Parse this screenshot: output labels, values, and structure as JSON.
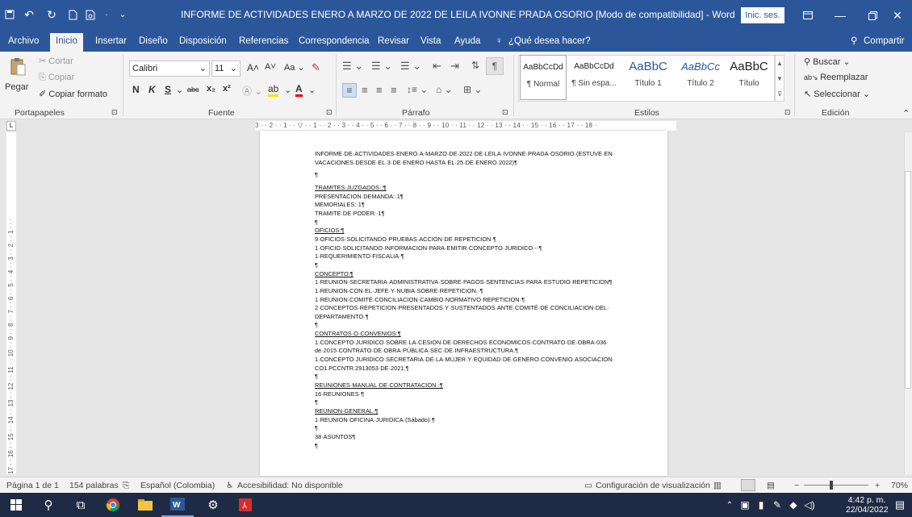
{
  "titlebar": {
    "title": "INFORME DE ACTIVIDADES ENERO A MARZO DE 2022 DE LEILA IVONNE PRADA OSORIO [Modo de compatibilidad]  -  Word",
    "signin": "Inic. ses.",
    "icons": [
      "save-icon",
      "undo-icon",
      "redo-icon",
      "new-document-icon",
      "print-preview-icon",
      "customize-icon"
    ]
  },
  "tabs": [
    "Archivo",
    "Inicio",
    "Insertar",
    "Diseño",
    "Disposición",
    "Referencias",
    "Correspondencia",
    "Revisar",
    "Vista",
    "Ayuda"
  ],
  "tell_me": "¿Qué desea hacer?",
  "share": "Compartir",
  "ribbon": {
    "clipboard": {
      "paste": "Pegar",
      "cut": "Cortar",
      "copy": "Copiar",
      "format_painter": "Copiar formato",
      "label": "Portapapeles"
    },
    "font": {
      "name": "Calibri",
      "size": "11",
      "case": "Aa",
      "bold": "N",
      "italic": "K",
      "underline": "S",
      "strike": "abc",
      "sub": "x₂",
      "sup": "x²",
      "label": "Fuente"
    },
    "paragraph": {
      "label": "Párrafo"
    },
    "styles": {
      "items": [
        {
          "preview": "AaBbCcDd",
          "name": "¶ Normal"
        },
        {
          "preview": "AaBbCcDd",
          "name": "¶ Sin espa..."
        },
        {
          "preview": "AaBbC",
          "name": "Título 1"
        },
        {
          "preview": "AaBbCc",
          "name": "Título 2"
        },
        {
          "preview": "AaBbC",
          "name": "Título"
        }
      ],
      "label": "Estilos"
    },
    "editing": {
      "find": "Buscar",
      "replace": "Reemplazar",
      "select": "Seleccionar",
      "label": "Edición"
    }
  },
  "ruler": {
    "h": "3 · · 2 · · 1 · · ▽ · · 1 · · 2 · · 3 · · 4 · · 5 · · 6 · · 7 · · 8 · · 9 · · 10 · · 11 · · 12 · · 13 · · 14 · · 15 · · 16 · · 17 · · 18 ·",
    "v": "17 · · 16 · · 15 · · 14 · · 13 · · 12 · · 11 · · 10 · · 9 · · 8 · · 7 · · 6 · · 5 · · 4 · · 3 · · 2 · · 1 · · ·"
  },
  "document": {
    "lines": [
      "INFORME·DE·ACTIVIDADES·ENERO·A·MARZO·DE·2022·DE·LEILA·IVONNE·PRADA·OSORIO·(ESTUVE·EN·",
      "VACACIONES·DESDE·EL·3·DE·ENERO·HASTA·EL·25·DE·ENERO·2022)¶",
      "",
      "¶",
      "",
      "TRAMITES·JUZGADOS·:¶",
      "PRESENTACION·DEMANDA:·1¶",
      "MEMORIALES:·1¶",
      "TRAMITE·DE·PODER:·1¶",
      "¶",
      "OFICIOS:¶",
      "9·OFICIOS·SOLICITANDO·PRUEBAS·ACCION·DE·REPETICION·¶",
      "1·OFICIO·SOLICITANDO·INFORMACION·PARA·EMITIR·CONCEPTO·JURIDICO·-·¶",
      "1·REQUERIMIENTO·FISCALIA·¶",
      "¶",
      "CONCEPTO:¶",
      "1·REUNION·SECRETARIA·ADMINISTRATIVA·SOBRE·PAGOS·SENTENCIAS·PARA·ESTUDIO·REPETICION¶",
      "1·REUNION·CON·EL·JEFE·Y·NUBIA·SOBRE·REPETICION.·¶",
      "1·REUNION·COMITÉ·CONCILIACION·CAMBIO·NORMATIVO·REPETICION·¶",
      "2·CONCEPTOS·REPETICION·PRESENTADOS·Y·SUSTENTADOS·ANTE·COMITÉ·DE·CONCILIACION·DEL·",
      "DEPARTAMENTO·¶",
      "¶",
      "CONTRATOS·O·CONVENIOS:¶",
      "1·CONCEPTO·JURIDICO·SOBRE·LA·CESION·DE·DERECHOS·ECONOMICOS·CONTRATO·DE·OBRA·036·",
      "de·2015·CONTRATO·DE·OBRA·PÚBLICA·SEC·DE·INFRAESTRUCTURA.¶",
      "1·CONCEPTO·JURIDICO·SECRETARIA·DE·LA·MUJER·Y·EQUIDAD·DE·GENERO·CONVENIO·ASOCIACION·",
      "CO1.PCCNTR.2913053·DE·2021.¶",
      "¶",
      "REUNIONES·MANUAL·DE·CONTRATACION·:¶",
      "16·REUNIONES·¶",
      "¶",
      "REUNION·GENERAL·¶",
      "1·REUNION·OFICINA·JURIDICA·(Sábado)·¶",
      "¶",
      "38·ASUNTOS¶",
      "¶"
    ],
    "underlined": [
      5,
      10,
      15,
      22,
      28,
      31
    ]
  },
  "status": {
    "page": "Página 1 de 1",
    "words": "154 palabras",
    "language": "Español (Colombia)",
    "accessibility": "Accesibilidad: No disponible",
    "display": "Configuración de visualización",
    "zoom": "70%"
  },
  "taskbar": {
    "time": "4:42 p. m.",
    "date": "22/04/2022"
  },
  "colors": {
    "accent": "#2b579a",
    "taskbar": "#1f2a44"
  }
}
